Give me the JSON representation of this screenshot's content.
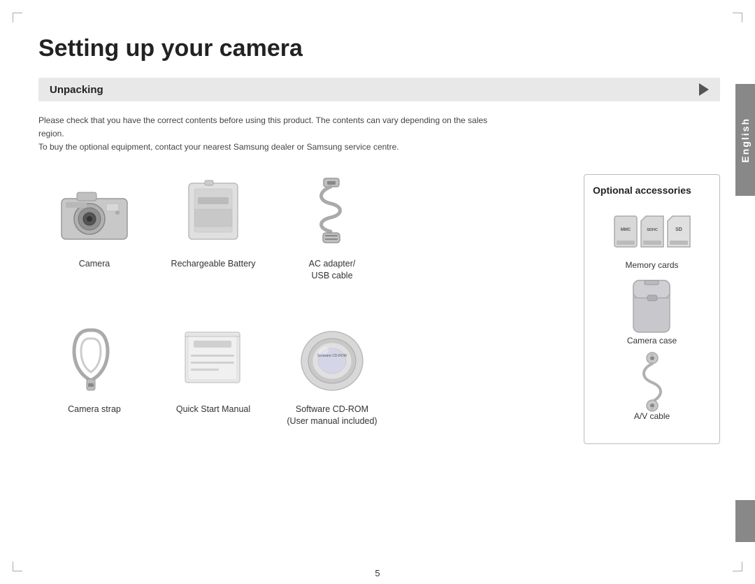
{
  "page": {
    "title": "Setting up your camera",
    "section": "Unpacking",
    "description": "Please check that you have the correct contents before using this product. The contents can vary depending on the sales region.\nTo buy the optional equipment, contact your nearest Samsung dealer or Samsung service centre.",
    "language": "English",
    "page_number": "5"
  },
  "items": [
    {
      "id": "camera",
      "label": "Camera"
    },
    {
      "id": "battery",
      "label": "Rechargeable Battery"
    },
    {
      "id": "ac_adapter",
      "label": "AC adapter/\nUSB cable"
    },
    {
      "id": "strap",
      "label": "Camera strap"
    },
    {
      "id": "manual",
      "label": "Quick Start Manual"
    },
    {
      "id": "cdrom",
      "label": "Software CD-ROM\n(User manual included)"
    }
  ],
  "optional": {
    "title": "Optional accessories",
    "items": [
      {
        "id": "memory_cards",
        "label": "Memory cards"
      },
      {
        "id": "camera_case",
        "label": "Camera case"
      },
      {
        "id": "av_cable",
        "label": "A/V cable"
      }
    ],
    "memory_cards": [
      "MMC",
      "SDHC",
      "SD"
    ]
  }
}
